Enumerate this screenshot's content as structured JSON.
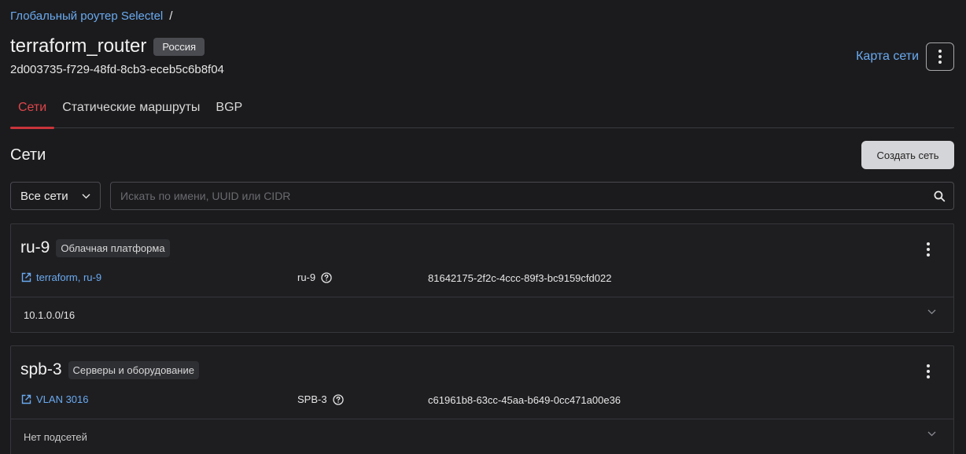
{
  "breadcrumb": {
    "parent": "Глобальный роутер Selectel",
    "separator": "/"
  },
  "router": {
    "name": "terraform_router",
    "region": "Россия",
    "uuid": "2d003735-f729-48fd-8cb3-eceb5c6b8f04"
  },
  "header": {
    "network_map": "Карта сети",
    "more_icon": "kebab-vertical-icon"
  },
  "tabs": [
    {
      "label": "Сети",
      "active": true
    },
    {
      "label": "Статические маршруты",
      "active": false
    },
    {
      "label": "BGP",
      "active": false
    }
  ],
  "section": {
    "title": "Сети",
    "create_button": "Создать сеть"
  },
  "filter": {
    "selected": "Все сети",
    "search_placeholder": "Искать по имени, UUID или CIDR"
  },
  "networks": [
    {
      "name": "ru-9",
      "type": "Облачная платформа",
      "link": "terraform, ru-9",
      "zone": "ru-9",
      "id": "81642175-2f2c-4ccc-89f3-bc9159cfd022",
      "subnet": "10.1.0.0/16"
    },
    {
      "name": "spb-3",
      "type": "Серверы и оборудование",
      "link": "VLAN 3016",
      "zone": "SPB-3",
      "id": "c61961b8-63cc-45aa-b649-0cc471a00e36",
      "subnet": "Нет подсетей"
    }
  ],
  "colors": {
    "background": "#1b1b1d",
    "link": "#6aaaf0",
    "accent": "#c9353a",
    "button": "#d4d5d8"
  }
}
